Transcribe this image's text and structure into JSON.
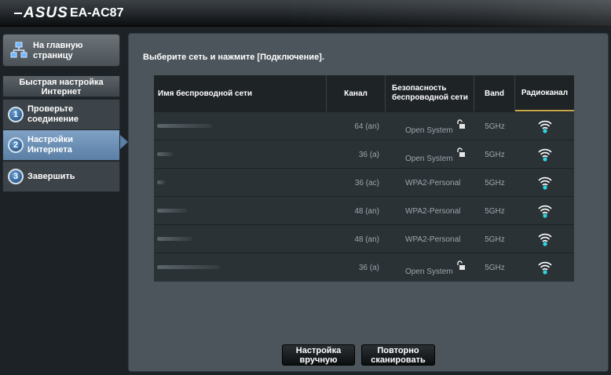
{
  "header": {
    "brand": "ASUS",
    "model": "EA-AC87"
  },
  "sidebar": {
    "home_label": "На главную страницу",
    "quick_setup_title": "Быстрая настройка Интернет",
    "steps": [
      {
        "num": "1",
        "label": "Проверьте соединение",
        "active": false
      },
      {
        "num": "2",
        "label": "Настройки Интернета",
        "active": true
      },
      {
        "num": "3",
        "label": "Завершить",
        "active": false
      }
    ]
  },
  "main": {
    "prompt": "Выберите сеть и нажмите [Подключение].",
    "table": {
      "headers": {
        "ssid": "Имя беспроводной сети",
        "channel": "Канал",
        "security": "Безопасность беспроводной сети",
        "band": "Band",
        "radio": "Радиоканал"
      },
      "rows": [
        {
          "ssid": "",
          "channel": "64 (an)",
          "security": "Open System",
          "open": true,
          "band": "5GHz",
          "signal_icon": "wifi-signal-icon"
        },
        {
          "ssid": "",
          "channel": "36 (a)",
          "security": "Open System",
          "open": true,
          "band": "5GHz",
          "signal_icon": "wifi-signal-icon"
        },
        {
          "ssid": "",
          "channel": "36 (ac)",
          "security": "WPA2-Personal",
          "open": false,
          "band": "5GHz",
          "signal_icon": "wifi-signal-icon"
        },
        {
          "ssid": "",
          "channel": "48 (an)",
          "security": "WPA2-Personal",
          "open": false,
          "band": "5GHz",
          "signal_icon": "wifi-signal-icon"
        },
        {
          "ssid": "",
          "channel": "48 (an)",
          "security": "WPA2-Personal",
          "open": false,
          "band": "5GHz",
          "signal_icon": "wifi-signal-icon"
        },
        {
          "ssid": "",
          "channel": "36 (a)",
          "security": "Open System",
          "open": true,
          "band": "5GHz",
          "signal_icon": "wifi-signal-icon"
        }
      ]
    },
    "buttons": {
      "manual": "Настройка вручную",
      "rescan": "Повторно сканировать"
    }
  },
  "colors": {
    "accent_blue": "#5b7fa5",
    "signal": "#2fd6e0",
    "radio_underline": "#c9a84a"
  }
}
